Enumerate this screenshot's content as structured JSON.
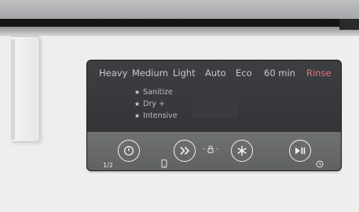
{
  "programs": [
    {
      "label": "Heavy"
    },
    {
      "label": "Medium"
    },
    {
      "label": "Light"
    },
    {
      "label": "Auto"
    },
    {
      "label": "Eco"
    },
    {
      "label": "60 min"
    },
    {
      "label": "Rinse",
      "active": true
    }
  ],
  "options": [
    {
      "label": "Sanitize"
    },
    {
      "label": "Dry +"
    },
    {
      "label": "Intensive"
    }
  ],
  "buttons": {
    "power": "power-icon",
    "program": "double-chevron-icon",
    "option": "asterisk-icon",
    "start": "play-pause-icon",
    "half_load": "1/2",
    "child_lock_sep": "-"
  },
  "colors": {
    "active_program": "#e0797a",
    "display_bg": "#3a3b3d",
    "button_bar": "#676a69"
  }
}
